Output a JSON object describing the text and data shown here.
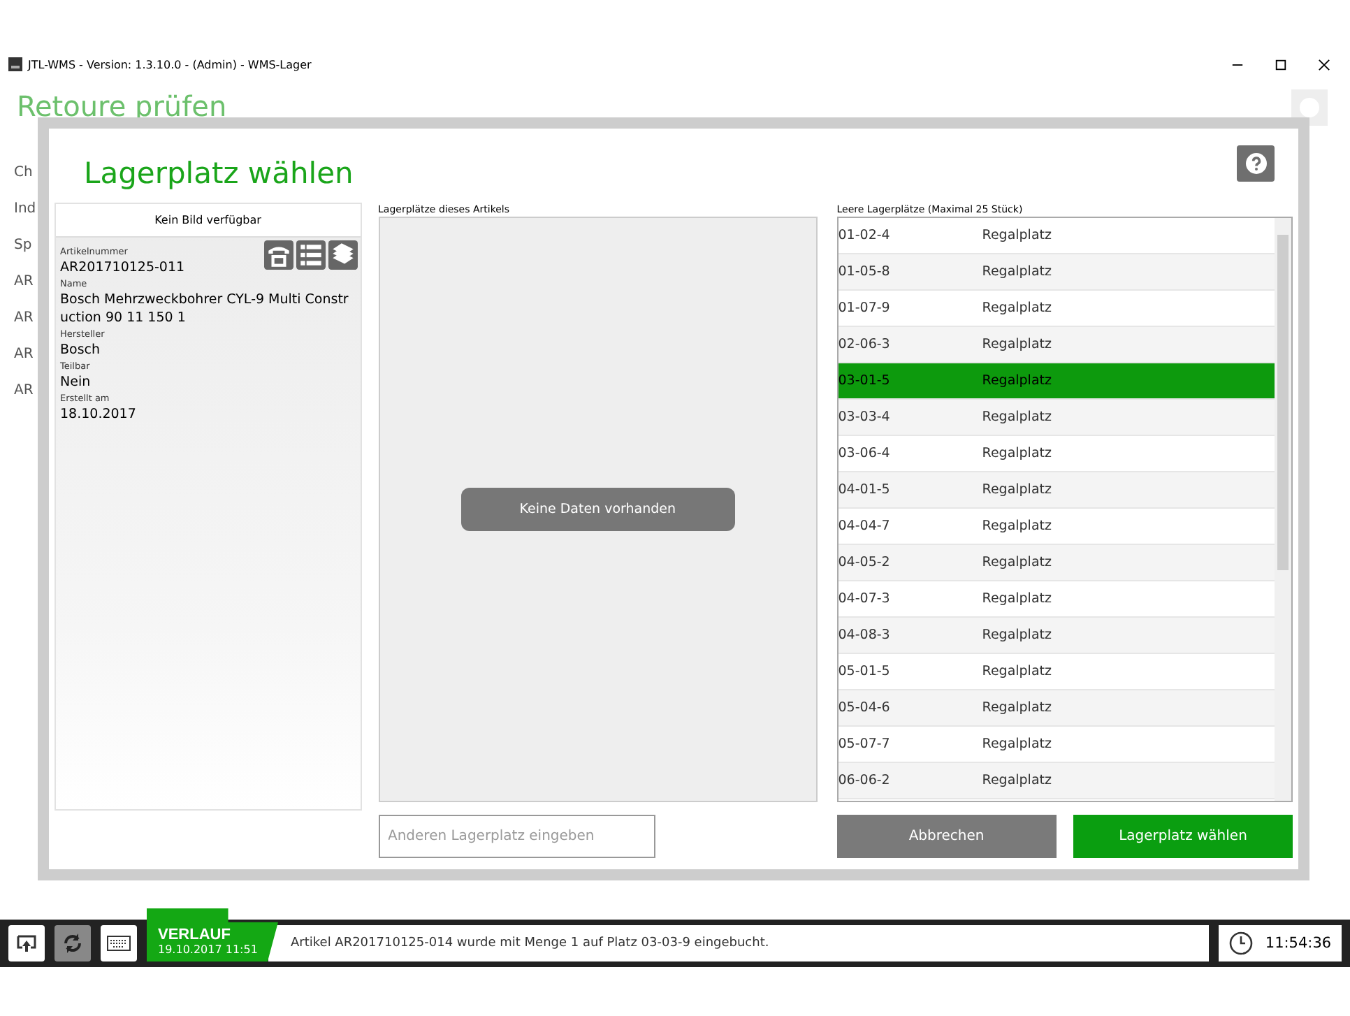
{
  "window": {
    "title": "JTL-WMS - Version: 1.3.10.0 - (Admin) - WMS-Lager"
  },
  "background": {
    "title": "Retoure prüfen",
    "fragments": [
      "Ch",
      "Ind",
      "Sp",
      "AR",
      "AR",
      "AR",
      "AR"
    ]
  },
  "dialog": {
    "title": "Lagerplatz wählen",
    "article": {
      "image_text": "Kein Bild verfügbar",
      "fields": [
        {
          "label": "Artikelnummer",
          "value": "AR201710125-011"
        },
        {
          "label": "Name",
          "value": "Bosch Mehrzweckbohrer CYL-9 Multi Construction 90 11 150 1"
        },
        {
          "label": "Hersteller",
          "value": "Bosch"
        },
        {
          "label": "Teilbar",
          "value": "Nein"
        },
        {
          "label": "Erstellt am",
          "value": "18.10.2017"
        }
      ]
    },
    "article_locations": {
      "label": "Lagerplätze dieses Artikels",
      "empty_text": "Keine Daten vorhanden"
    },
    "free_locations": {
      "label": "Leere Lagerplätze (Maximal 25 Stück)",
      "rows": [
        {
          "place": "01-02-4",
          "type": "Regalplatz",
          "selected": false
        },
        {
          "place": "01-05-8",
          "type": "Regalplatz",
          "selected": false
        },
        {
          "place": "01-07-9",
          "type": "Regalplatz",
          "selected": false
        },
        {
          "place": "02-06-3",
          "type": "Regalplatz",
          "selected": false
        },
        {
          "place": "03-01-5",
          "type": "Regalplatz",
          "selected": true
        },
        {
          "place": "03-03-4",
          "type": "Regalplatz",
          "selected": false
        },
        {
          "place": "03-06-4",
          "type": "Regalplatz",
          "selected": false
        },
        {
          "place": "04-01-5",
          "type": "Regalplatz",
          "selected": false
        },
        {
          "place": "04-04-7",
          "type": "Regalplatz",
          "selected": false
        },
        {
          "place": "04-05-2",
          "type": "Regalplatz",
          "selected": false
        },
        {
          "place": "04-07-3",
          "type": "Regalplatz",
          "selected": false
        },
        {
          "place": "04-08-3",
          "type": "Regalplatz",
          "selected": false
        },
        {
          "place": "05-01-5",
          "type": "Regalplatz",
          "selected": false
        },
        {
          "place": "05-04-6",
          "type": "Regalplatz",
          "selected": false
        },
        {
          "place": "05-07-7",
          "type": "Regalplatz",
          "selected": false
        },
        {
          "place": "06-06-2",
          "type": "Regalplatz",
          "selected": false
        }
      ]
    },
    "other_location": {
      "placeholder": "Anderen Lagerplatz eingeben"
    },
    "buttons": {
      "cancel": "Abbrechen",
      "confirm": "Lagerplatz wählen"
    }
  },
  "taskbar": {
    "history_title": "VERLAUF",
    "history_time": "19.10.2017 11:51",
    "message": "Artikel AR201710125-014 wurde mit Menge 1 auf Platz 03-03-9 eingebucht.",
    "clock": "11:54:36"
  }
}
